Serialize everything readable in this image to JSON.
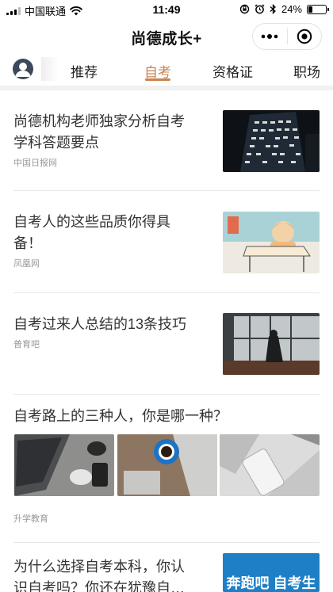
{
  "status_bar": {
    "carrier": "中国联通",
    "time": "11:49",
    "battery_text": "24%",
    "battery_level": 0.24,
    "icons": [
      "signal-icon",
      "wifi-icon",
      "orientation-lock-icon",
      "alarm-icon",
      "bluetooth-icon",
      "battery-icon"
    ]
  },
  "nav": {
    "title": "尚德成长+",
    "icons": [
      "more-icon",
      "close-mini-program-icon"
    ]
  },
  "tabs": {
    "items": [
      {
        "label": "推荐",
        "active": false
      },
      {
        "label": "自考",
        "active": true
      },
      {
        "label": "资格证",
        "active": false
      },
      {
        "label": "职场",
        "active": false
      }
    ],
    "accent_color": "#c98350"
  },
  "articles": [
    {
      "title_line1": "尚德机构老师独家分析自考",
      "title_line2": "学科答题要点",
      "source": "中国日报网"
    },
    {
      "title_line1": "自考人的这些品质你得具",
      "title_line2": "备！",
      "source": "凤凰网"
    },
    {
      "title_line1": "自考过来人总结的13条技巧",
      "source": "普育吧"
    },
    {
      "title_line1": "自考路上的三种人，你是哪一种？",
      "source": "升学教育"
    },
    {
      "title_line1": "为什么选择自考本科，你认",
      "title_line2": "识自考吗？你还在犹豫自…",
      "thumb_text": "奔跑吧 自考生"
    }
  ]
}
